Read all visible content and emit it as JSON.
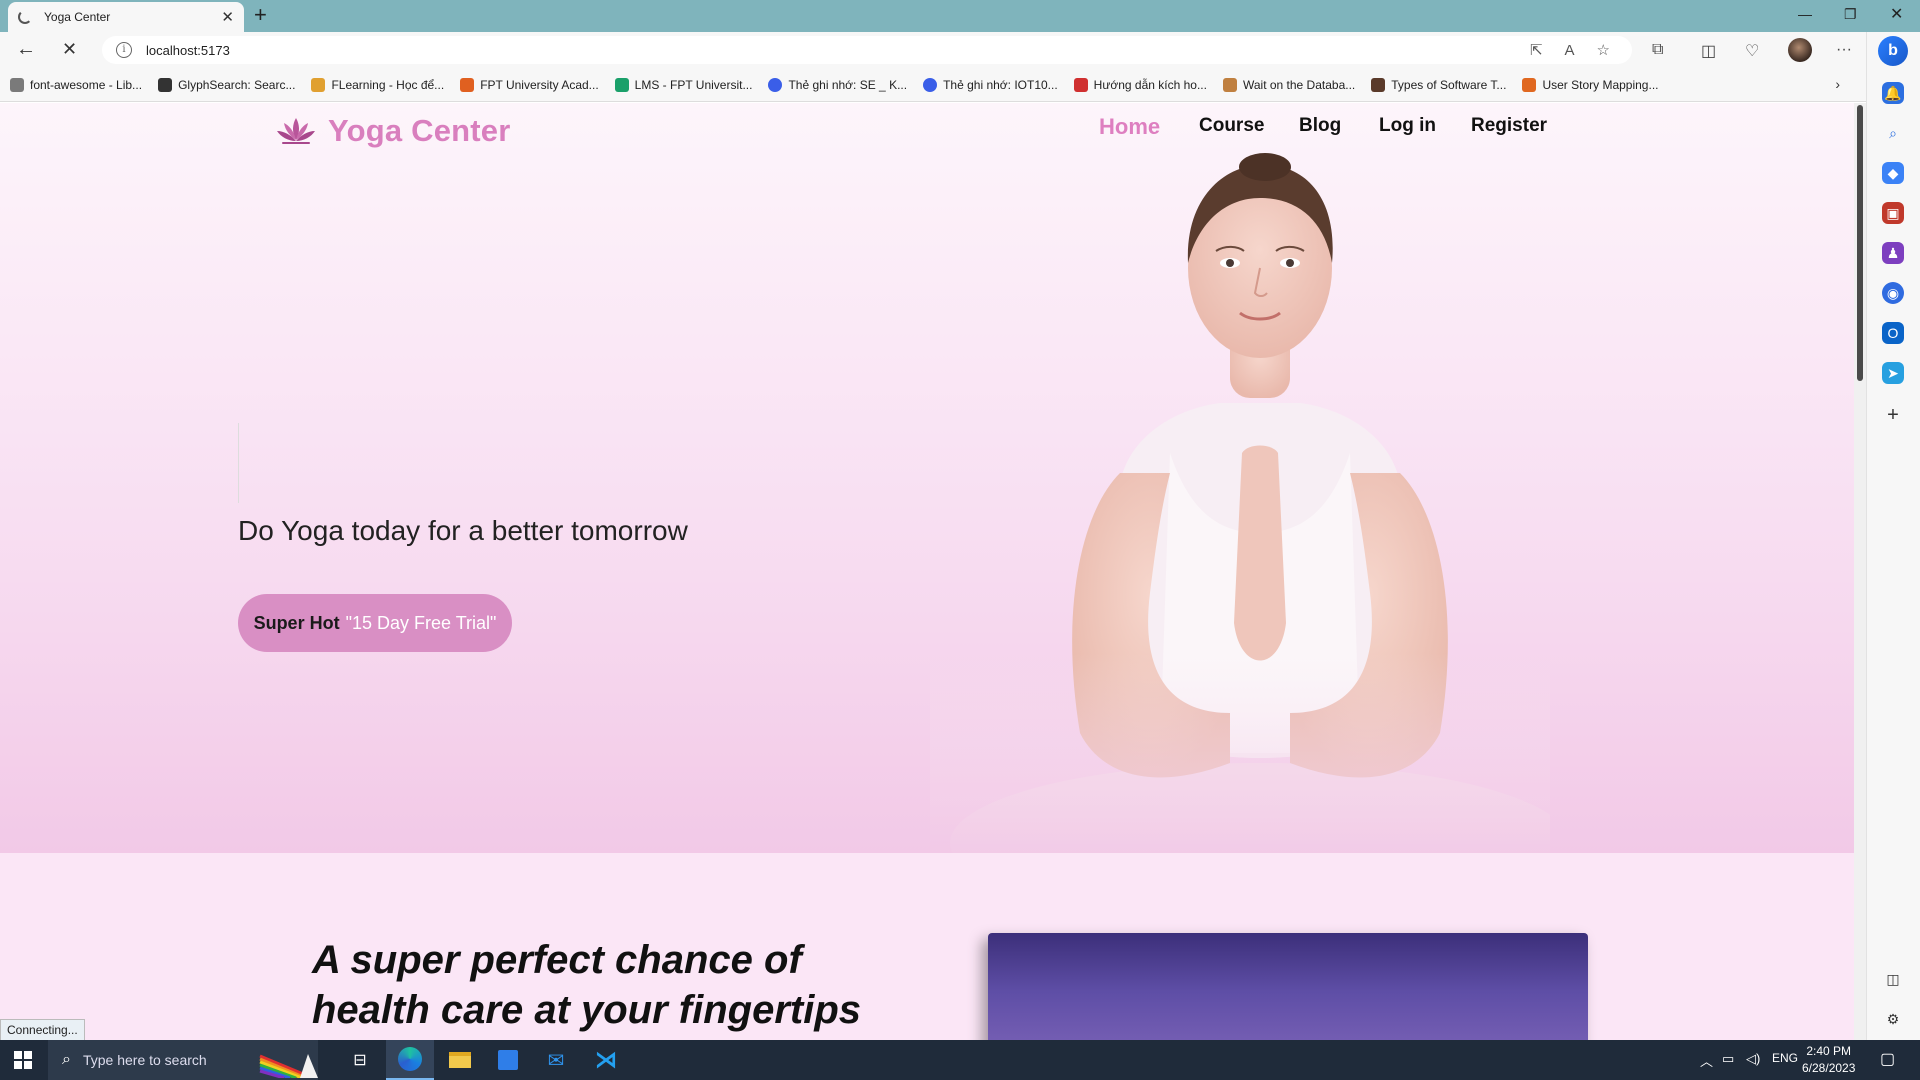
{
  "browser": {
    "tab_title": "Yoga Center",
    "url": "localhost:5173",
    "bookmarks": [
      {
        "label": "font-awesome - Lib...",
        "color": "#7a7a7a"
      },
      {
        "label": "GlyphSearch: Searc...",
        "color": "#333333"
      },
      {
        "label": "FLearning - Học để...",
        "color": "#e0a030"
      },
      {
        "label": "FPT University Acad...",
        "color": "#e06020"
      },
      {
        "label": "LMS - FPT Universit...",
        "color": "#1aa06a"
      },
      {
        "label": "Thẻ ghi nhớ: SE _ K...",
        "color": "#3a5ee8"
      },
      {
        "label": "Thẻ ghi nhớ: IOT10...",
        "color": "#3a5ee8"
      },
      {
        "label": "Hướng dẫn kích ho...",
        "color": "#d03030"
      },
      {
        "label": "Wait on the Databa...",
        "color": "#c08040"
      },
      {
        "label": "Types of Software T...",
        "color": "#5a3a2a"
      },
      {
        "label": "User Story Mapping...",
        "color": "#e06820"
      }
    ],
    "status_text": "Connecting..."
  },
  "site": {
    "logo_text": "Yoga Center",
    "nav": {
      "home": "Home",
      "course": "Course",
      "blog": "Blog",
      "login": "Log in",
      "register": "Register"
    },
    "hero": {
      "tagline": "Do Yoga today for a better tomorrow",
      "button_hot": "Super Hot",
      "button_offer": "\"15 Day Free Trial\""
    },
    "section2": {
      "title_line1": "A super perfect chance of",
      "title_line2": "health care at your fingertips"
    },
    "colors": {
      "accent": "#de7fc0",
      "button": "#d98fc4",
      "hero_bottom": "#f2c9e7"
    }
  },
  "taskbar": {
    "search_placeholder": "Type here to search",
    "language": "ENG",
    "time": "2:40 PM",
    "date": "6/28/2023"
  }
}
